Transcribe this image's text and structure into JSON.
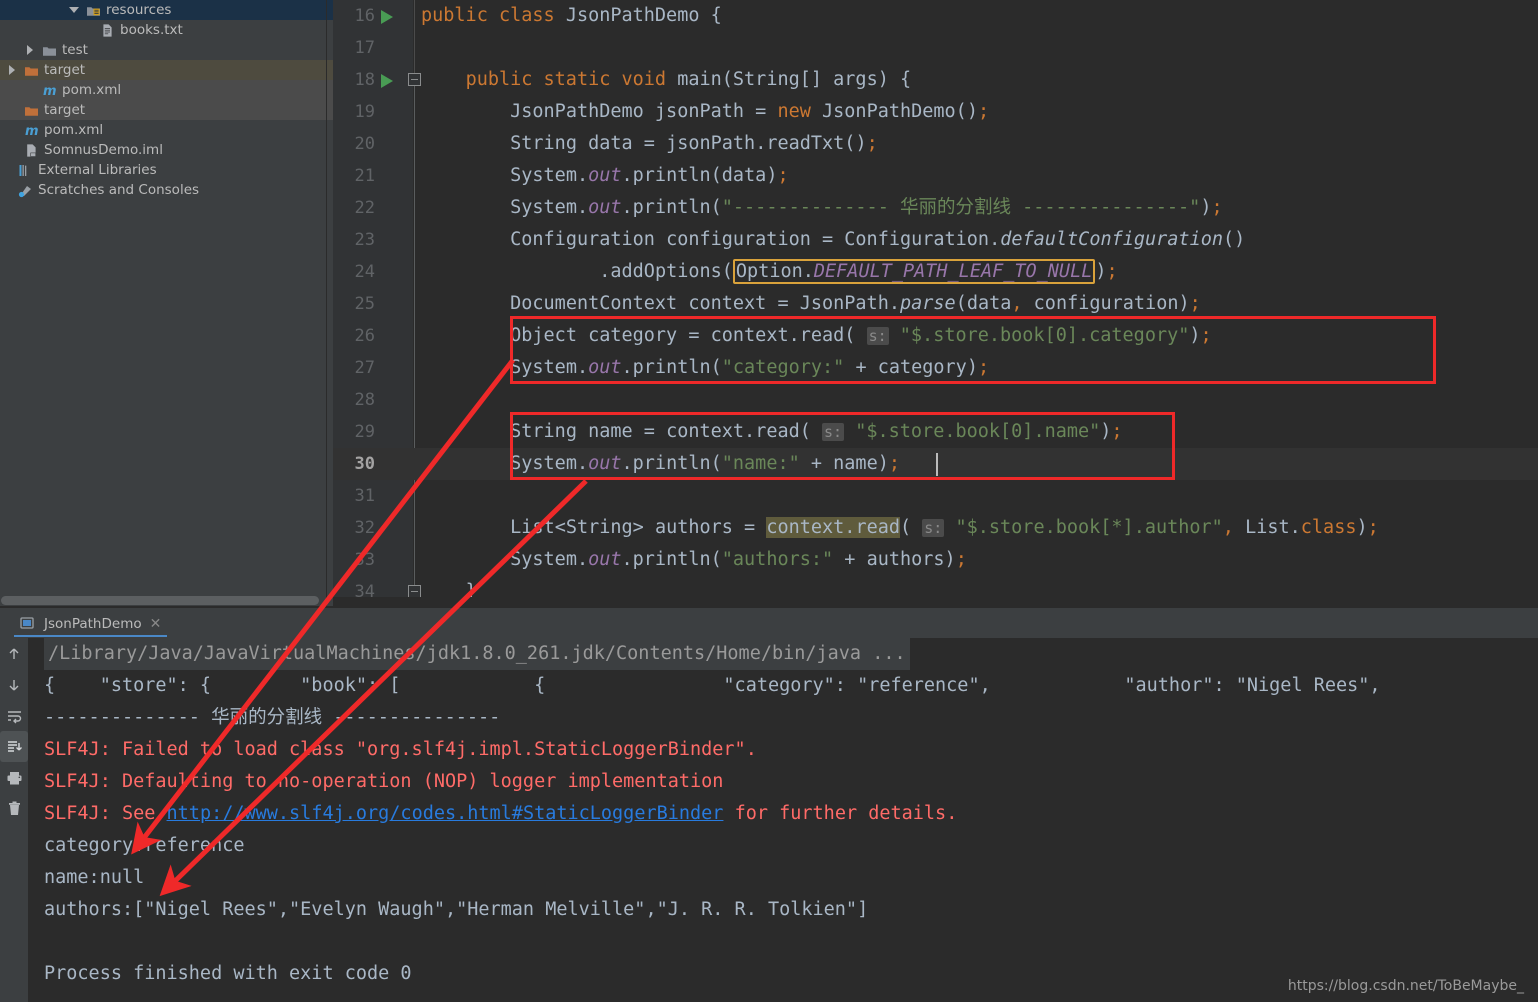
{
  "sidebar": {
    "items": [
      {
        "label": "resources",
        "icon": "folder-resources-icon",
        "state": "selected-blue",
        "indent": 68,
        "arrow": "open"
      },
      {
        "label": "books.txt",
        "icon": "text-file-icon",
        "state": "none",
        "indent": 82,
        "arrow": "none"
      },
      {
        "label": "test",
        "icon": "folder-icon",
        "state": "none",
        "indent": 24,
        "arrow": "closed"
      },
      {
        "label": "target",
        "icon": "folder-orange-icon",
        "state": "selected-grey",
        "indent": 6,
        "arrow": "closed"
      },
      {
        "label": "pom.xml",
        "icon": "maven-icon",
        "state": "selected-grey2",
        "indent": 24,
        "arrow": "none"
      },
      {
        "label": "target",
        "icon": "folder-orange-icon",
        "state": "selected-grey2",
        "indent": 6,
        "arrow": "none"
      },
      {
        "label": "pom.xml",
        "icon": "maven-icon",
        "state": "none",
        "indent": 6,
        "arrow": "none"
      },
      {
        "label": "SomnusDemo.iml",
        "icon": "iml-file-icon",
        "state": "none",
        "indent": 6,
        "arrow": "none"
      },
      {
        "label": "External Libraries",
        "icon": "library-icon",
        "state": "none",
        "indent": 0,
        "arrow": "none"
      },
      {
        "label": "Scratches and Consoles",
        "icon": "scratches-icon",
        "state": "none",
        "indent": 0,
        "arrow": "none"
      }
    ]
  },
  "editor": {
    "first_line": 16,
    "current_line": 30,
    "lines": [
      {
        "n": 16,
        "runnable": true,
        "fold": "none",
        "text": "public class JsonPathDemo {"
      },
      {
        "n": 17,
        "runnable": false,
        "fold": "none",
        "text": ""
      },
      {
        "n": 18,
        "runnable": true,
        "fold": "start",
        "text": "    public static void main(String[] args) {"
      },
      {
        "n": 19,
        "runnable": false,
        "fold": "none",
        "text": "        JsonPathDemo jsonPath = new JsonPathDemo();"
      },
      {
        "n": 20,
        "runnable": false,
        "fold": "none",
        "text": "        String data = jsonPath.readTxt();"
      },
      {
        "n": 21,
        "runnable": false,
        "fold": "none",
        "text": "        System.out.println(data);"
      },
      {
        "n": 22,
        "runnable": false,
        "fold": "none",
        "text": "        System.out.println(\"-------------- 华丽的分割线 ---------------\");"
      },
      {
        "n": 23,
        "runnable": false,
        "fold": "none",
        "text": "        Configuration configuration = Configuration.defaultConfiguration()"
      },
      {
        "n": 24,
        "runnable": false,
        "fold": "none",
        "text": "                .addOptions(Option.DEFAULT_PATH_LEAF_TO_NULL);"
      },
      {
        "n": 25,
        "runnable": false,
        "fold": "none",
        "text": "        DocumentContext context = JsonPath.parse(data, configuration);"
      },
      {
        "n": 26,
        "runnable": false,
        "fold": "none",
        "text": "        Object category = context.read( s: \"$.store.book[0].category\");"
      },
      {
        "n": 27,
        "runnable": false,
        "fold": "none",
        "text": "        System.out.println(\"category:\" + category);"
      },
      {
        "n": 28,
        "runnable": false,
        "fold": "none",
        "text": ""
      },
      {
        "n": 29,
        "runnable": false,
        "fold": "none",
        "text": "        String name = context.read( s: \"$.store.book[0].name\");"
      },
      {
        "n": 30,
        "runnable": false,
        "fold": "none",
        "text": "        System.out.println(\"name:\" + name);"
      },
      {
        "n": 31,
        "runnable": false,
        "fold": "none",
        "text": ""
      },
      {
        "n": 32,
        "runnable": false,
        "fold": "none",
        "text": "        List<String> authors = context.read( s: \"$.store.book[*].author\", List.class);"
      },
      {
        "n": 33,
        "runnable": false,
        "fold": "none",
        "text": "        System.out.println(\"authors:\" + authors);"
      },
      {
        "n": 34,
        "runnable": false,
        "fold": "end",
        "text": "    }"
      }
    ],
    "param_hint": "s:",
    "highlighted_option": "Option.DEFAULT_PATH_LEAF_TO_NULL"
  },
  "console": {
    "tab_label": "JsonPathDemo",
    "toolbar": [
      {
        "name": "scroll-up-icon",
        "glyph": "↑",
        "active": false
      },
      {
        "name": "scroll-down-icon",
        "glyph": "↓",
        "active": false
      },
      {
        "name": "soft-wrap-icon",
        "glyph": "wrap",
        "active": false
      },
      {
        "name": "scroll-to-end-icon",
        "glyph": "end",
        "active": true
      },
      {
        "name": "print-icon",
        "glyph": "print",
        "active": false
      },
      {
        "name": "clear-all-icon",
        "glyph": "trash",
        "active": false
      }
    ],
    "lines": [
      {
        "type": "cmd",
        "text": "/Library/Java/JavaVirtualMachines/jdk1.8.0_261.jdk/Contents/Home/bin/java ..."
      },
      {
        "type": "plain",
        "text": "{    \"store\": {        \"book\": [            {                \"category\": \"reference\",            \"author\": \"Nigel Rees\","
      },
      {
        "type": "plain",
        "text": "-------------- 华丽的分割线 ---------------"
      },
      {
        "type": "err",
        "text": "SLF4J: Failed to load class \"org.slf4j.impl.StaticLoggerBinder\"."
      },
      {
        "type": "err",
        "text": "SLF4J: Defaulting to no-operation (NOP) logger implementation"
      },
      {
        "type": "err-link",
        "prefix": "SLF4J: See ",
        "link": "http://www.slf4j.org/codes.html#StaticLoggerBinder",
        "suffix": " for further details."
      },
      {
        "type": "plain",
        "text": "category:reference"
      },
      {
        "type": "plain",
        "text": "name:null"
      },
      {
        "type": "plain",
        "text": "authors:[\"Nigel Rees\",\"Evelyn Waugh\",\"Herman Melville\",\"J. R. R. Tolkien\"]"
      },
      {
        "type": "plain",
        "text": ""
      },
      {
        "type": "plain",
        "text": "Process finished with exit code 0"
      }
    ]
  },
  "watermark": "https://blog.csdn.net/ToBeMaybe_",
  "colors": {
    "accent_red": "#ef2929",
    "keyword": "#cc7832",
    "string": "#6a8759",
    "field": "#9876aa",
    "error": "#ff6b68",
    "link": "#287bde",
    "highlight_box": "#d9a23b"
  }
}
